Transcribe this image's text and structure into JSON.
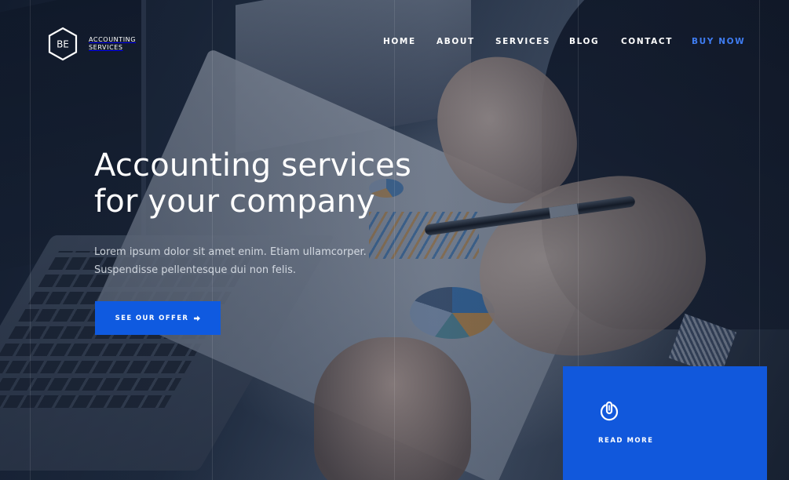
{
  "brand": {
    "monogram": "BE",
    "name_line1": "ACCOUNTING",
    "name_line2": "SERVICES",
    "icon": "hexagon-logo-icon"
  },
  "nav": {
    "items": [
      {
        "label": "HOME"
      },
      {
        "label": "ABOUT"
      },
      {
        "label": "SERVICES"
      },
      {
        "label": "BLOG"
      },
      {
        "label": "CONTACT"
      },
      {
        "label": "BUY NOW",
        "accent": true
      }
    ]
  },
  "hero": {
    "headline_line1": "Accounting services",
    "headline_line2": "for your company",
    "lead_line1": "Lorem ipsum dolor sit amet enim. Etiam ullamcorper.",
    "lead_line2": "Suspendisse pellentesque dui non felis.",
    "cta_label": "SEE OUR OFFER",
    "cta_icon": "arrow-right-icon"
  },
  "card": {
    "icon": "coin-icon",
    "link_label": "READ MORE"
  },
  "colors": {
    "accent": "#0F5AE0",
    "nav_accent": "#3F7DF2",
    "card_bg": "#1158DC",
    "text": "#FFFFFF"
  }
}
